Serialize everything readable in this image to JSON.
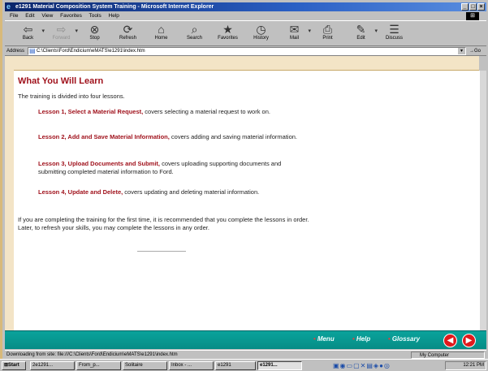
{
  "window": {
    "title": "e1291 Material Composition System Training - Microsoft Internet Explorer"
  },
  "menu": [
    "File",
    "Edit",
    "View",
    "Favorites",
    "Tools",
    "Help"
  ],
  "toolbar": [
    {
      "label": "Back",
      "icon": "back-arrow-icon",
      "glyph": "⇦",
      "enabled": true,
      "dropdown": true
    },
    {
      "label": "Forward",
      "icon": "forward-arrow-icon",
      "glyph": "⇨",
      "enabled": false,
      "dropdown": true
    },
    {
      "label": "Stop",
      "icon": "stop-icon",
      "glyph": "⊗",
      "enabled": true
    },
    {
      "label": "Refresh",
      "icon": "refresh-icon",
      "glyph": "⟳",
      "enabled": true
    },
    {
      "label": "Home",
      "icon": "home-icon",
      "glyph": "⌂",
      "enabled": true
    },
    {
      "label": "Search",
      "icon": "search-icon",
      "glyph": "⌕",
      "enabled": true
    },
    {
      "label": "Favorites",
      "icon": "favorites-icon",
      "glyph": "★",
      "enabled": true
    },
    {
      "label": "History",
      "icon": "history-icon",
      "glyph": "◷",
      "enabled": true
    },
    {
      "label": "Mail",
      "icon": "mail-icon",
      "glyph": "✉",
      "enabled": true,
      "dropdown": true
    },
    {
      "label": "Print",
      "icon": "print-icon",
      "glyph": "⎙",
      "enabled": true
    },
    {
      "label": "Edit",
      "icon": "edit-icon",
      "glyph": "✎",
      "enabled": true,
      "dropdown": true
    },
    {
      "label": "Discuss",
      "icon": "discuss-icon",
      "glyph": "☰",
      "enabled": true
    }
  ],
  "address": {
    "label": "Address",
    "value": "C:\\Clients\\Ford\\Endicium\\eMATS\\e1291\\index.htm",
    "go": "Go"
  },
  "page": {
    "title": "What You Will Learn",
    "intro": "The training is divided into four lessons.",
    "lessons": [
      {
        "title": "Lesson 1, Select a Material Request,",
        "desc": " covers selecting a material request to work on."
      },
      {
        "title": "Lesson 2, Add and Save Material Information,",
        "desc": " covers adding and saving material information."
      },
      {
        "title": "Lesson 3, Upload Documents and Submit,",
        "desc": " covers uploading supporting documents and submitting completed material information to Ford."
      },
      {
        "title": "Lesson 4, Update and Delete,",
        "desc": " covers updating and deleting material information."
      }
    ],
    "outro": "If you are completing the training for the first time, it is recommended that you complete the lessons in order. Later, to refresh your skills, you may complete the lessons in any order."
  },
  "nav": {
    "menu": "Menu",
    "help": "Help",
    "glossary": "Glossary",
    "back": "◀",
    "next": "▶"
  },
  "status": {
    "message": "Downloading from site: file:///C:\\Clients\\Ford\\Endicium\\eMATS\\e1291\\index.htm",
    "zone": "My Computer"
  },
  "taskbar": {
    "start": "Start",
    "tasks": [
      "2e1291...",
      "From_p...",
      "Solitaire",
      "Inbox - ...",
      "e1291",
      "e1291..."
    ],
    "clock": "12:21 PM"
  },
  "colors": {
    "accent": "#a0121c",
    "nav_bar": "#0aa39c",
    "frame": "#f3e4c6"
  }
}
